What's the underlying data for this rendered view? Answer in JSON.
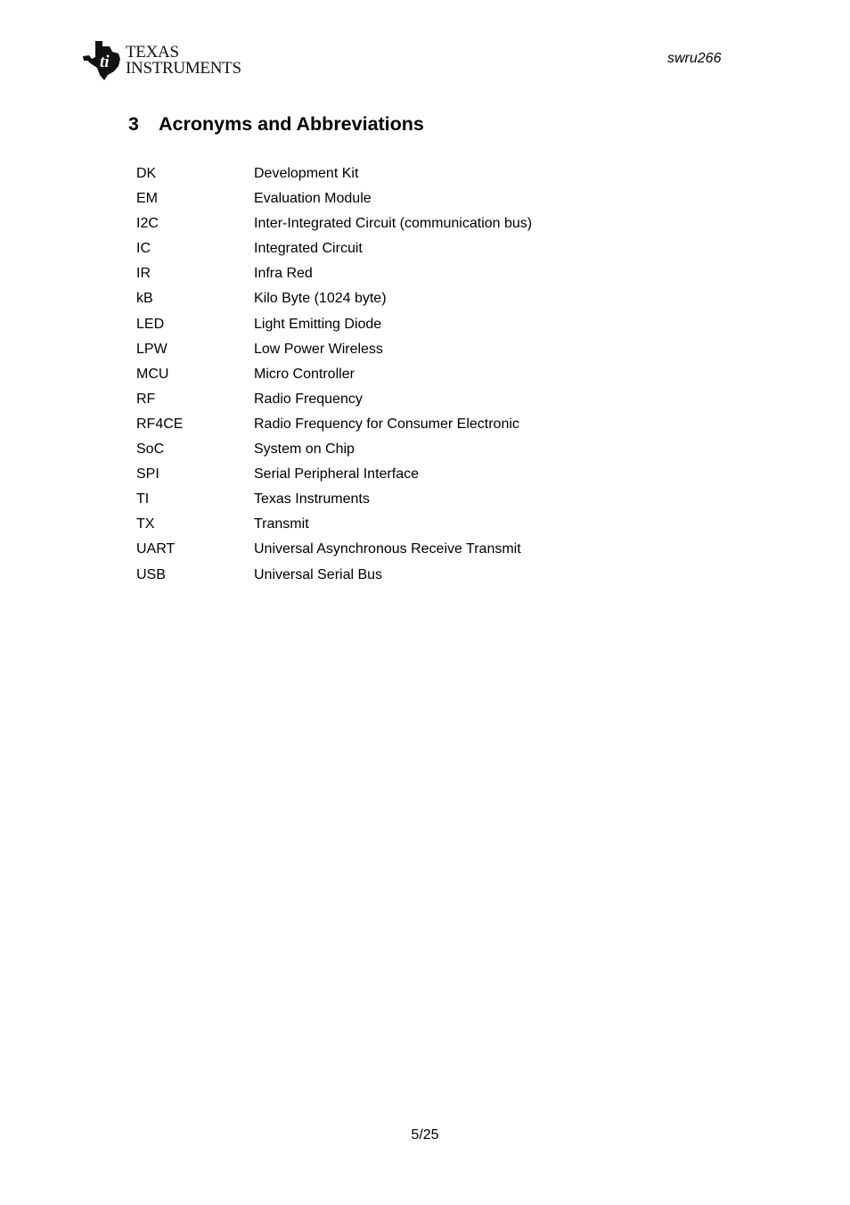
{
  "header": {
    "logo": {
      "icon": "texas-instruments-logo-icon",
      "line1": "Texas",
      "line2": "Instruments"
    },
    "doc_id": "swru266"
  },
  "section": {
    "number": "3",
    "title": "Acronyms and Abbreviations"
  },
  "acronyms": [
    {
      "term": "DK",
      "definition": "Development Kit"
    },
    {
      "term": "EM",
      "definition": "Evaluation Module"
    },
    {
      "term": "I2C",
      "definition": "Inter-Integrated Circuit (communication bus)"
    },
    {
      "term": "IC",
      "definition": "Integrated Circuit"
    },
    {
      "term": "IR",
      "definition": "Infra Red"
    },
    {
      "term": "kB",
      "definition": "Kilo Byte (1024 byte)"
    },
    {
      "term": "LED",
      "definition": "Light Emitting Diode"
    },
    {
      "term": "LPW",
      "definition": "Low Power Wireless"
    },
    {
      "term": "MCU",
      "definition": "Micro Controller"
    },
    {
      "term": "RF",
      "definition": "Radio Frequency"
    },
    {
      "term": "RF4CE",
      "definition": "Radio Frequency for Consumer Electronic"
    },
    {
      "term": "SoC",
      "definition": "System on Chip"
    },
    {
      "term": "SPI",
      "definition": "Serial Peripheral Interface"
    },
    {
      "term": "TI",
      "definition": "Texas Instruments"
    },
    {
      "term": "TX",
      "definition": "Transmit"
    },
    {
      "term": "UART",
      "definition": "Universal Asynchronous Receive Transmit"
    },
    {
      "term": "USB",
      "definition": "Universal Serial Bus"
    }
  ],
  "footer": {
    "page": "5/25"
  }
}
